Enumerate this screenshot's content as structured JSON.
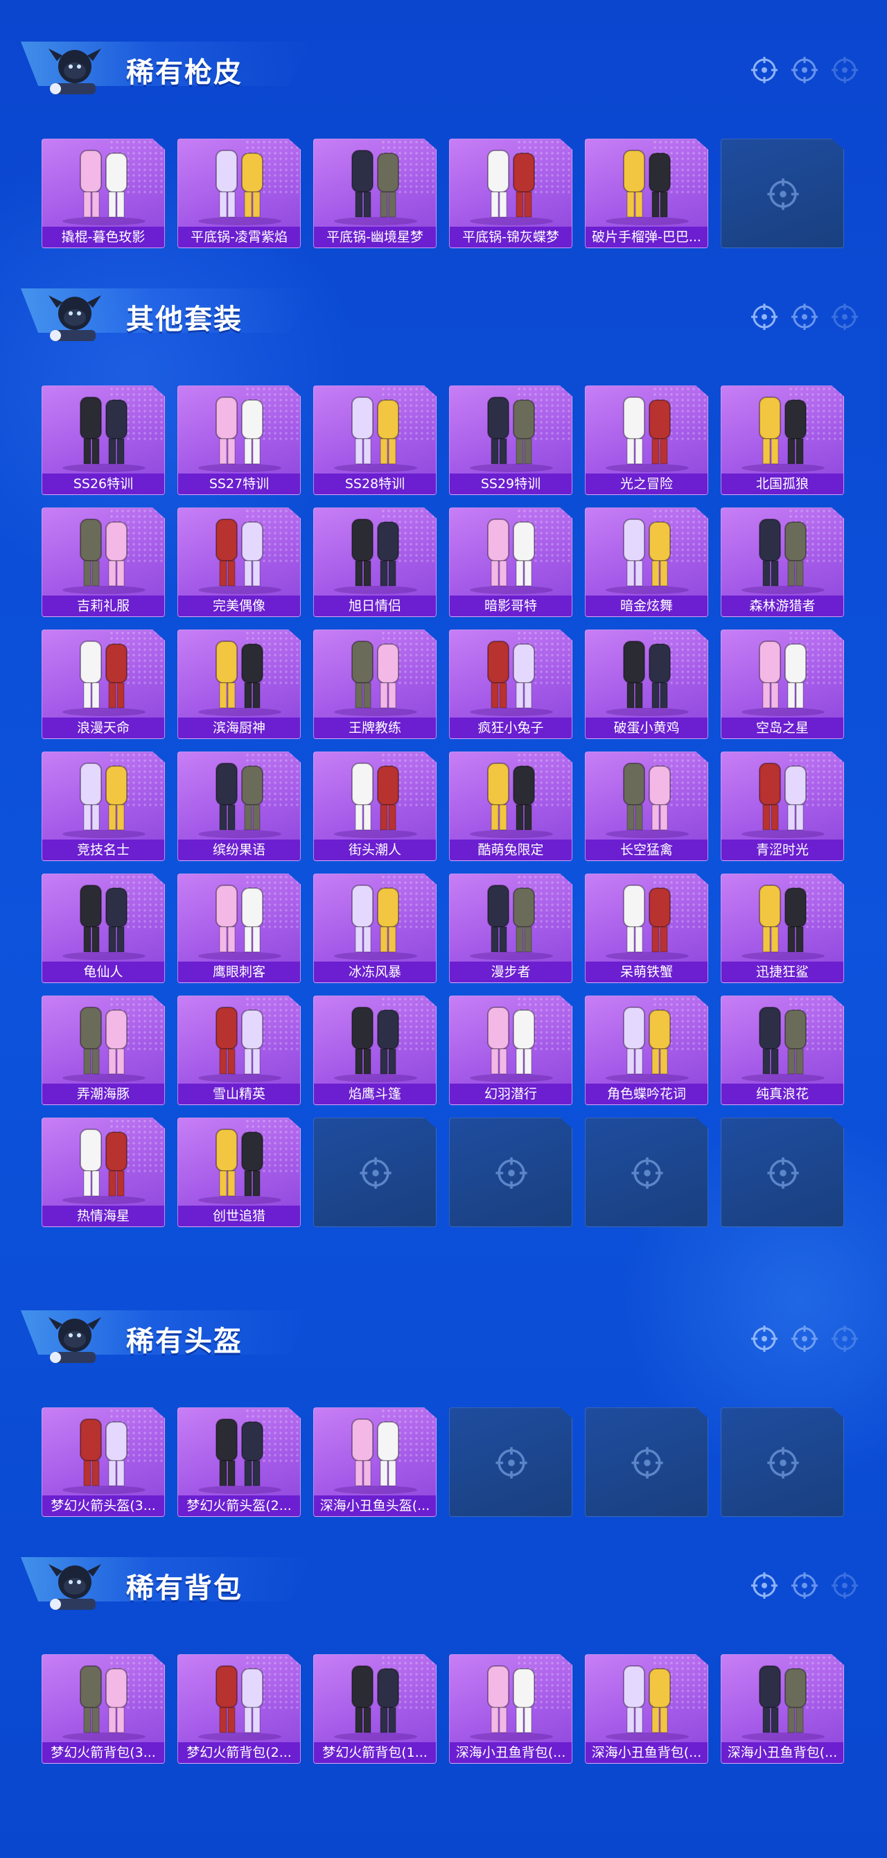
{
  "colors": {
    "background": "#0d4fd6",
    "card_fill": "#a55be8",
    "label_bar": "#6b1fd0",
    "empty_card": "#1d4690"
  },
  "sections": [
    {
      "title": "稀有枪皮",
      "items": [
        "撬棍-暮色玫影",
        "平底锅-凌霄紫焰",
        "平底锅-幽境星梦",
        "平底锅-锦灰蝶梦",
        "破片手榴弹-巴巴..."
      ],
      "empty_slots": 1
    },
    {
      "title": "其他套装",
      "items": [
        "SS26特训",
        "SS27特训",
        "SS28特训",
        "SS29特训",
        "光之冒险",
        "北国孤狼",
        "吉莉礼服",
        "完美偶像",
        "旭日情侣",
        "暗影哥特",
        "暗金炫舞",
        "森林游猎者",
        "浪漫天命",
        "滨海厨神",
        "王牌教练",
        "疯狂小兔子",
        "破蛋小黄鸡",
        "空岛之星",
        "竞技名士",
        "缤纷果语",
        "街头潮人",
        "酷萌兔限定",
        "长空猛禽",
        "青涩时光",
        "龟仙人",
        "鹰眼刺客",
        "冰冻风暴",
        "漫步者",
        "呆萌铁蟹",
        "迅捷狂鲨",
        "弄潮海豚",
        "雪山精英",
        "焰鹰斗篷",
        "幻羽潜行",
        "角色蝶吟花词",
        "纯真浪花",
        "热情海星",
        "创世追猎"
      ],
      "empty_slots": 4
    },
    {
      "title": "稀有头盔",
      "items": [
        "梦幻火箭头盔(3...",
        "梦幻火箭头盔(2...",
        "深海小丑鱼头盔(..."
      ],
      "empty_slots": 3
    },
    {
      "title": "稀有背包",
      "items": [
        "梦幻火箭背包(3...",
        "梦幻火箭背包(2...",
        "梦幻火箭背包(1...",
        "深海小丑鱼背包(...",
        "深海小丑鱼背包(...",
        "深海小丑鱼背包(..."
      ],
      "empty_slots": 0
    }
  ]
}
